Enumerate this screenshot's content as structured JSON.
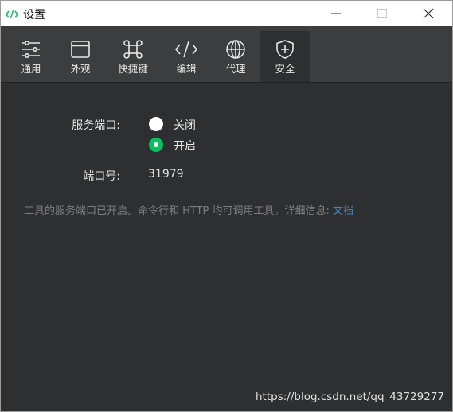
{
  "window": {
    "title": "设置"
  },
  "toolbar": {
    "tabs": [
      {
        "label": "通用",
        "icon": "sliders-icon"
      },
      {
        "label": "外观",
        "icon": "window-icon"
      },
      {
        "label": "快捷键",
        "icon": "command-key-icon"
      },
      {
        "label": "编辑",
        "icon": "code-icon"
      },
      {
        "label": "代理",
        "icon": "globe-icon"
      },
      {
        "label": "安全",
        "icon": "shield-plus-icon",
        "active": true
      }
    ]
  },
  "security": {
    "service_port_label": "服务端口:",
    "options": [
      {
        "label": "关闭",
        "selected": false
      },
      {
        "label": "开启",
        "selected": true
      }
    ],
    "port_number_label": "端口号:",
    "port_number_value": "31979",
    "info_text": "工具的服务端口已开启。命令行和 HTTP 均可调用工具。详细信息: ",
    "info_link": "文档"
  },
  "watermark": "https://blog.csdn.net/qq_43729277",
  "colors": {
    "background": "#2e2f30",
    "toolbar": "#3c3d3e",
    "accent": "#07c160",
    "link": "#4a7fb8"
  }
}
